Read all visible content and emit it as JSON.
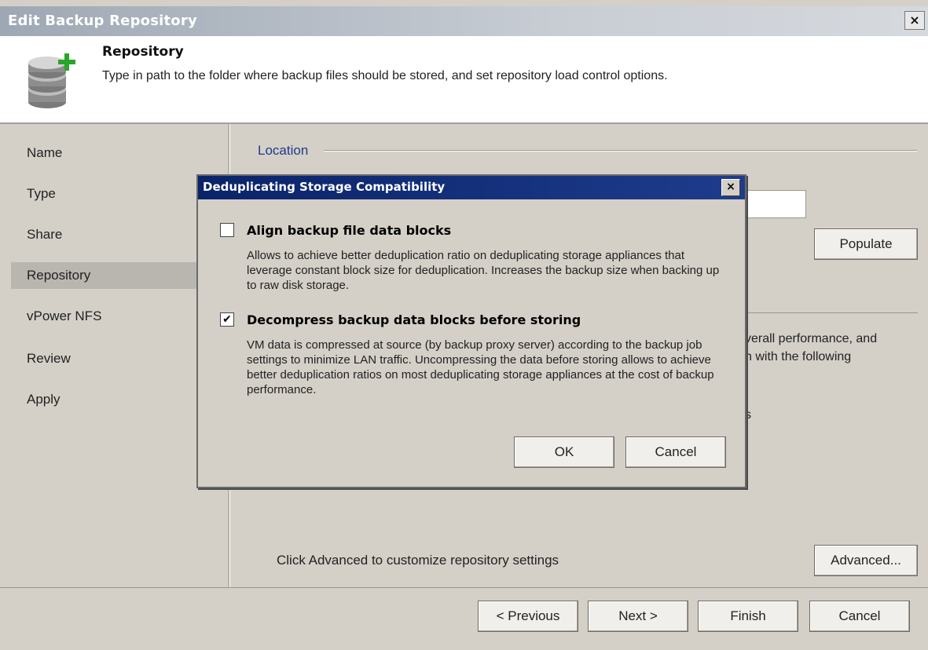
{
  "window": {
    "title": "Edit Backup Repository",
    "close_glyph": "×"
  },
  "header": {
    "title": "Repository",
    "description": "Type in path to the folder where backup files should be stored, and set repository load control options.",
    "icon": "database-add-icon"
  },
  "sidebar": {
    "items": [
      {
        "label": "Name",
        "active": false
      },
      {
        "label": "Type",
        "active": false
      },
      {
        "label": "Share",
        "active": false
      },
      {
        "label": "Repository",
        "active": true
      },
      {
        "label": "vPower NFS",
        "active": false
      },
      {
        "label": "Review",
        "active": false
      },
      {
        "label": "Apply",
        "active": false
      }
    ]
  },
  "main": {
    "location_label": "Location",
    "populate_label": "Populate",
    "perf_line1": "verall performance, and",
    "perf_line2": "n with the following",
    "perf_tail": "s",
    "advanced_hint": "Click Advanced to customize repository settings",
    "advanced_label": "Advanced..."
  },
  "footer": {
    "previous_label": "< Previous",
    "next_label": "Next >",
    "finish_label": "Finish",
    "cancel_label": "Cancel"
  },
  "dialog": {
    "title": "Deduplicating Storage Compatibility",
    "close_glyph": "×",
    "option1": {
      "label": "Align backup file data blocks",
      "checked": false,
      "description": "Allows to achieve better deduplication ratio on deduplicating storage appliances that leverage constant block size for deduplication. Increases the backup size when backing up to raw disk storage."
    },
    "option2": {
      "label": "Decompress backup data blocks before storing",
      "checked": true,
      "check_glyph": "✔",
      "description": "VM data is compressed at source (by backup proxy server) according to the backup job settings to minimize LAN traffic. Uncompressing the data before storing allows to achieve better deduplication ratios on most deduplicating storage appliances at the cost of backup performance."
    },
    "ok_label": "OK",
    "cancel_label": "Cancel"
  }
}
